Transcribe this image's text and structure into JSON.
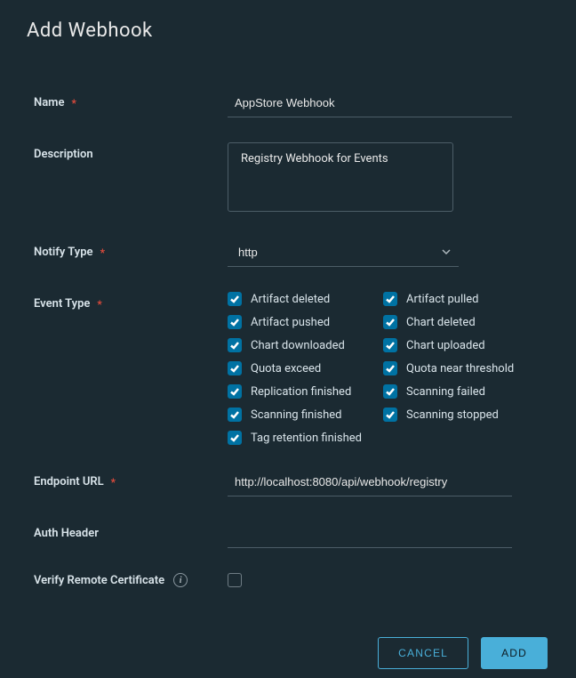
{
  "title": "Add Webhook",
  "labels": {
    "name": "Name",
    "description": "Description",
    "notify_type": "Notify Type",
    "event_type": "Event Type",
    "endpoint_url": "Endpoint URL",
    "auth_header": "Auth Header",
    "verify_cert": "Verify Remote Certificate"
  },
  "required_marker": "*",
  "fields": {
    "name": "AppStore Webhook",
    "description": "Registry Webhook for Events",
    "notify_type": "http",
    "endpoint_url": "http://localhost:8080/api/webhook/registry",
    "auth_header": "",
    "verify_cert_checked": false
  },
  "event_types": [
    {
      "label": "Artifact deleted",
      "checked": true
    },
    {
      "label": "Artifact pulled",
      "checked": true
    },
    {
      "label": "Artifact pushed",
      "checked": true
    },
    {
      "label": "Chart deleted",
      "checked": true
    },
    {
      "label": "Chart downloaded",
      "checked": true
    },
    {
      "label": "Chart uploaded",
      "checked": true
    },
    {
      "label": "Quota exceed",
      "checked": true
    },
    {
      "label": "Quota near threshold",
      "checked": true
    },
    {
      "label": "Replication finished",
      "checked": true
    },
    {
      "label": "Scanning failed",
      "checked": true
    },
    {
      "label": "Scanning finished",
      "checked": true
    },
    {
      "label": "Scanning stopped",
      "checked": true
    },
    {
      "label": "Tag retention finished",
      "checked": true
    }
  ],
  "buttons": {
    "cancel": "CANCEL",
    "add": "ADD"
  },
  "info_glyph": "i"
}
